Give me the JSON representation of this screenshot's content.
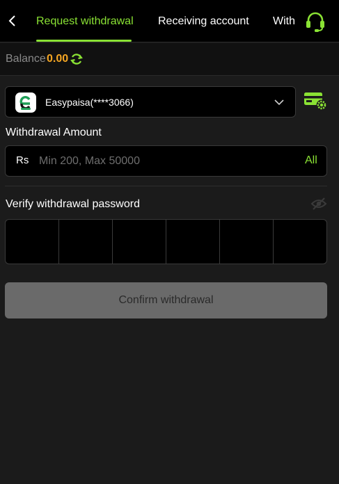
{
  "header": {
    "tabs": [
      {
        "label": "Request withdrawal",
        "active": true
      },
      {
        "label": "Receiving account",
        "active": false
      },
      {
        "label": "Withdrawal records",
        "active": false
      }
    ],
    "icons": {
      "back": "chevron-left-icon",
      "support": "headset-icon"
    }
  },
  "balance": {
    "label": "Balance",
    "value": "0.00"
  },
  "account": {
    "name": "Easypaisa(****3066)",
    "logo_letter": "e"
  },
  "amount": {
    "label": "Withdrawal Amount",
    "currency": "Rs",
    "placeholder": "Min 200, Max 50000",
    "value": "",
    "all_label": "All"
  },
  "password": {
    "label": "Verify withdrawal password",
    "digits": [
      "",
      "",
      "",
      "",
      "",
      ""
    ]
  },
  "confirm": {
    "label": "Confirm withdrawal"
  },
  "colors": {
    "accent": "#8ae234",
    "balance": "#f5a623",
    "background": "#1b1b1b",
    "header": "#000000",
    "button_disabled": "#6a6a6a"
  }
}
